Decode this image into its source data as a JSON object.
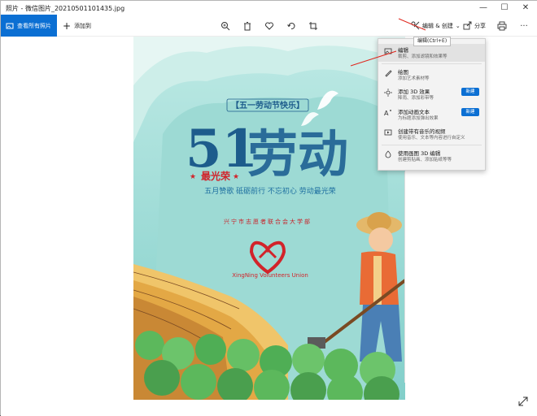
{
  "window": {
    "title": "照片 - 微信图片_20210501101435.jpg",
    "minimize": "—",
    "maximize": "☐",
    "close": "✕"
  },
  "toolbar": {
    "view_all_label": "查看所有照片",
    "add_to_label": "添加到",
    "edit_create_label": "编辑 & 创建",
    "share_label": "分享",
    "more_label": "···"
  },
  "tooltip": "编辑(Ctrl+E)",
  "menu": {
    "items": [
      {
        "label": "编辑",
        "sub": "裁剪、添加滤镜和效果等",
        "icon": "image-edit-icon"
      },
      {
        "label": "绘图",
        "sub": "添加艺术素材等",
        "icon": "pen-icon"
      },
      {
        "label": "添加 3D 效果",
        "sub": "降雨、添加彩带等",
        "icon": "sparkle-3d-icon",
        "badge": "新建"
      },
      {
        "label": "添加动画文本",
        "sub": "为标题添加弹出效果",
        "icon": "animated-text-icon",
        "badge": "新建"
      },
      {
        "label": "创建带有音乐的视频",
        "sub": "使用音乐、文本等内容进行自定义",
        "icon": "video-music-icon"
      },
      {
        "label": "使用画图 3D 编辑",
        "sub": "创建剪贴画、添加贴纸等等",
        "icon": "paint3d-icon"
      }
    ]
  },
  "poster": {
    "banner": "【五一劳动节快乐】",
    "big_number": "51",
    "big_text": "劳动",
    "subtitle": "最光荣",
    "tagline": "五月赞歌 砥砺前行 不忘初心 劳动最光荣",
    "org_arc": "兴宁市志愿者联合会大学部",
    "org_en": "XingNing  Volunteers  Union"
  },
  "statusbar": "",
  "colors": {
    "accent": "#0b6fd3",
    "poster_teal": "#8fd3cf",
    "title_blue": "#1d5c8c",
    "red": "#d2232a"
  }
}
